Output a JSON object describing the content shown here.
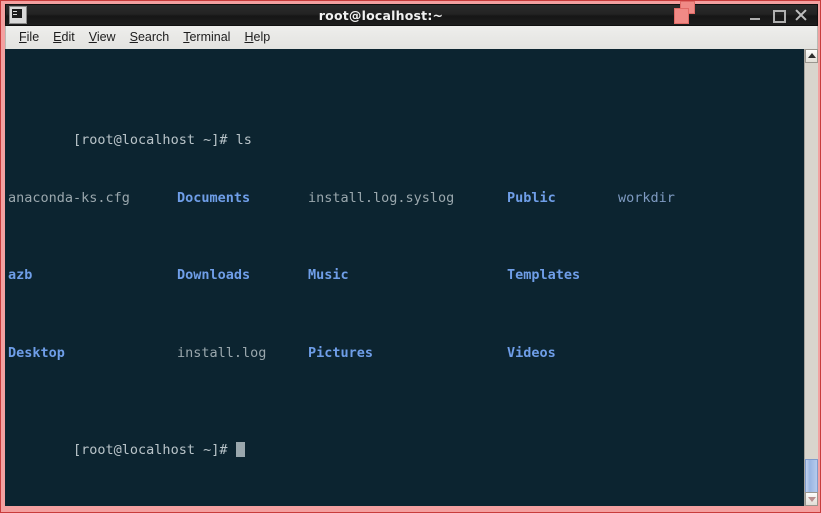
{
  "window": {
    "title": "root@localhost:~",
    "icon_name": "terminal-window-icon",
    "border_color": "#f4a0a0",
    "controls": {
      "minimize_label": "Minimize",
      "maximize_label": "Maximize",
      "close_label": "Close"
    }
  },
  "menubar": {
    "items": [
      {
        "label": "File",
        "mnemonic": "F",
        "rest": "ile"
      },
      {
        "label": "Edit",
        "mnemonic": "E",
        "rest": "dit"
      },
      {
        "label": "View",
        "mnemonic": "V",
        "rest": "iew"
      },
      {
        "label": "Search",
        "mnemonic": "S",
        "rest": "earch"
      },
      {
        "label": "Terminal",
        "mnemonic": "T",
        "rest": "erminal"
      },
      {
        "label": "Help",
        "mnemonic": "H",
        "rest": "elp"
      }
    ]
  },
  "terminal": {
    "background_color": "#0c2430",
    "prompt_color": "#b9c4c9",
    "file_color": "#9aa7ad",
    "dir_color": "#6f9ee8",
    "prompt": "[root@localhost ~]#",
    "command": " ls",
    "prompt_line_1": "[root@localhost ~]# ls",
    "prompt_line_2": "[root@localhost ~]# ",
    "cursor_visible": true,
    "listing": {
      "rows": [
        [
          {
            "name": "anaconda-ks.cfg",
            "kind": "file"
          },
          {
            "name": "Documents",
            "kind": "dir"
          },
          {
            "name": "install.log.syslog",
            "kind": "file"
          },
          {
            "name": "Public",
            "kind": "dir"
          },
          {
            "name": "workdir",
            "kind": "dir-dim"
          }
        ],
        [
          {
            "name": "azb",
            "kind": "dir"
          },
          {
            "name": "Downloads",
            "kind": "dir"
          },
          {
            "name": "Music",
            "kind": "dir"
          },
          {
            "name": "Templates",
            "kind": "dir"
          },
          {
            "name": "",
            "kind": "file"
          }
        ],
        [
          {
            "name": "Desktop",
            "kind": "dir"
          },
          {
            "name": "install.log",
            "kind": "file"
          },
          {
            "name": "Pictures",
            "kind": "dir"
          },
          {
            "name": "Videos",
            "kind": "dir"
          },
          {
            "name": "",
            "kind": "file"
          }
        ]
      ]
    }
  },
  "scrollbar": {
    "up_arrow": "▲",
    "down_arrow": "▼",
    "thumb_position_pct": 92
  }
}
